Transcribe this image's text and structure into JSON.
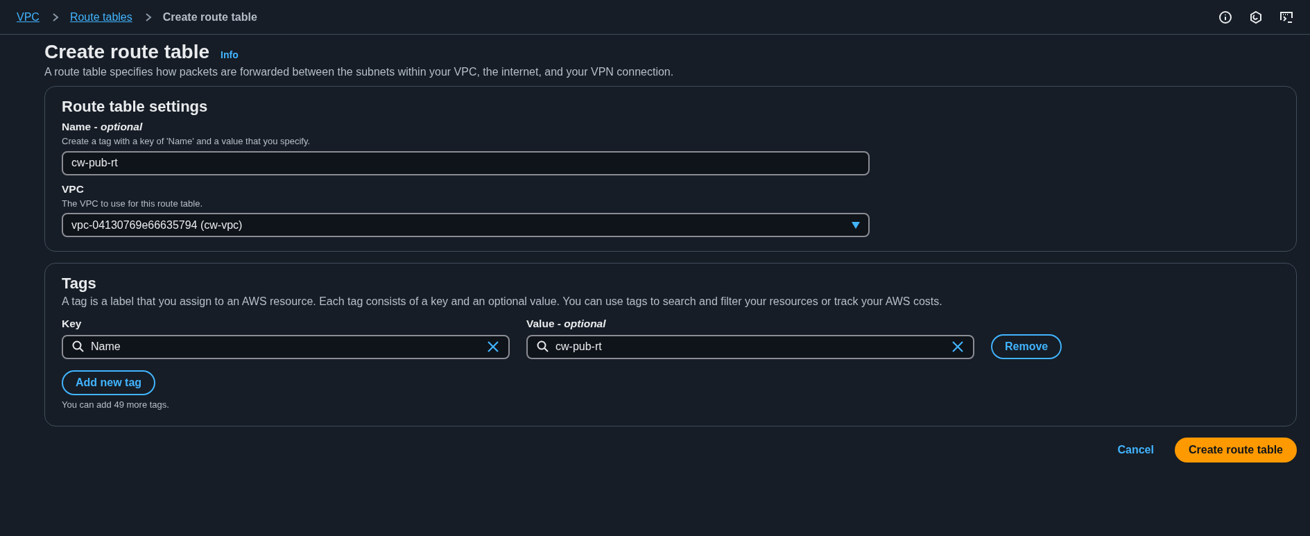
{
  "breadcrumbs": [
    {
      "label": "VPC",
      "kind": "link"
    },
    {
      "label": "Route tables",
      "kind": "link"
    },
    {
      "label": "Create route table",
      "kind": "current"
    }
  ],
  "header": {
    "title": "Create route table",
    "info": "Info",
    "description": "A route table specifies how packets are forwarded between the subnets within your VPC, the internet, and your VPN connection."
  },
  "settings": {
    "title": "Route table settings",
    "fields": [
      {
        "kind": "text",
        "label": "Name - *optional*",
        "hint": "Create a tag with a key of 'Name' and a value that you specify.",
        "value": "cw-pub-rt"
      },
      {
        "kind": "select",
        "label": "VPC",
        "hint": "The VPC to use for this route table.",
        "value": "vpc-04130769e66635794 (cw-vpc)"
      }
    ]
  },
  "tags": {
    "title": "Tags",
    "description": "A tag is a label that you assign to an AWS resource. Each tag consists of a key and an optional value. You can use tags to search and filter your resources or track your AWS costs.",
    "key_label": "Key",
    "value_label": "Value - *optional*",
    "rows": [
      {
        "key": "Name",
        "value": "cw-pub-rt",
        "remove": "Remove"
      }
    ],
    "add_button": "Add new tag",
    "limit_note": "You can add 49 more tags."
  },
  "actions": {
    "cancel": "Cancel",
    "submit": "Create route table"
  }
}
